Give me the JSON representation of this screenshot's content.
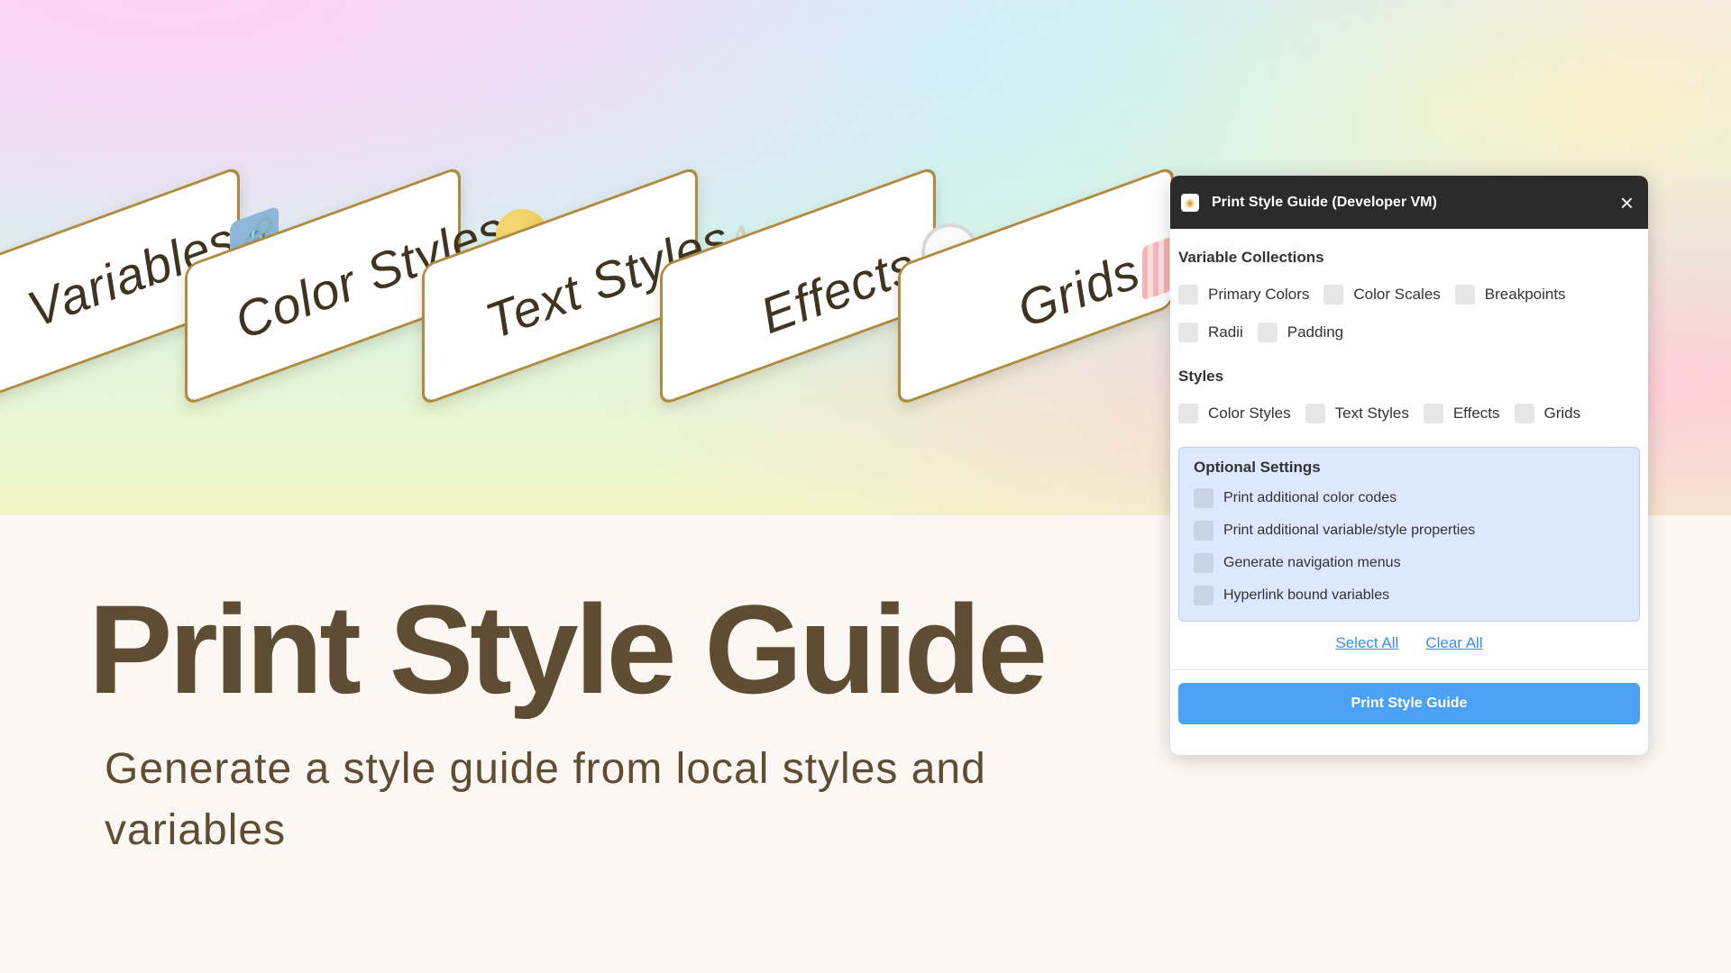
{
  "hero": {
    "cards": [
      {
        "label": "Variables",
        "icon": "chain-link-icon"
      },
      {
        "label": "Color Styles",
        "icon": "yellow-circle-icon"
      },
      {
        "label": "Text Styles",
        "icon": "typography-aa-icon",
        "icon_text": "Aa"
      },
      {
        "label": "Effects",
        "icon": "drop-shadow-circle-icon"
      },
      {
        "label": "Grids",
        "icon": "grid-columns-icon"
      }
    ]
  },
  "headline": {
    "title": "Print Style Guide",
    "subtitle": "Generate a style guide from local styles and variables"
  },
  "panel": {
    "title": "Print Style Guide (Developer VM)",
    "close_icon": "close-icon",
    "variable_collections": {
      "heading": "Variable Collections",
      "items": [
        "Primary Colors",
        "Color Scales",
        "Breakpoints",
        "Radii",
        "Padding"
      ]
    },
    "styles": {
      "heading": "Styles",
      "items": [
        "Color Styles",
        "Text Styles",
        "Effects",
        "Grids"
      ]
    },
    "optional_settings": {
      "heading": "Optional Settings",
      "items": [
        "Print additional color codes",
        "Print additional variable/style properties",
        "Generate navigation menus",
        "Hyperlink bound variables"
      ]
    },
    "select_all": "Select All",
    "clear_all": "Clear All",
    "print_button": "Print Style Guide"
  },
  "colors": {
    "brand_brown": "#5e4d33",
    "card_border": "#b08a3e",
    "panel_titlebar": "#2b2b2b",
    "primary_button": "#4da1f4",
    "link": "#3d8be8",
    "optional_bg": "#dbe8ff"
  }
}
